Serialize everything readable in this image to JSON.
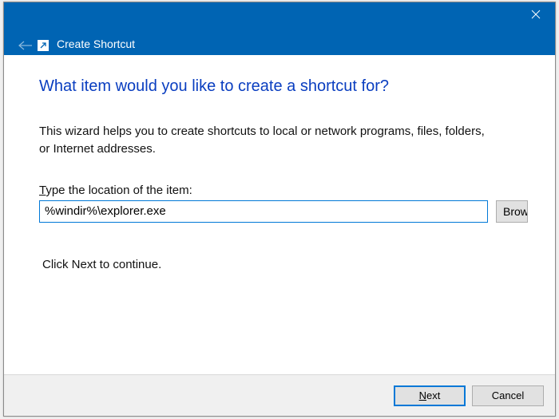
{
  "window": {
    "title": "Create Shortcut"
  },
  "wizard": {
    "heading": "What item would you like to create a shortcut for?",
    "description": "This wizard helps you to create shortcuts to local or network programs, files, folders,\nor Internet addresses.",
    "location_hotkey": "T",
    "location_label_rest": "ype the location of the item:",
    "location_value": "%windir%\\explorer.exe",
    "browse_hotkey": "B",
    "browse_rest": "rowse...",
    "continue_text": "Click Next to continue."
  },
  "footer": {
    "next_hotkey": "N",
    "next_rest": "ext",
    "cancel": "Cancel"
  }
}
